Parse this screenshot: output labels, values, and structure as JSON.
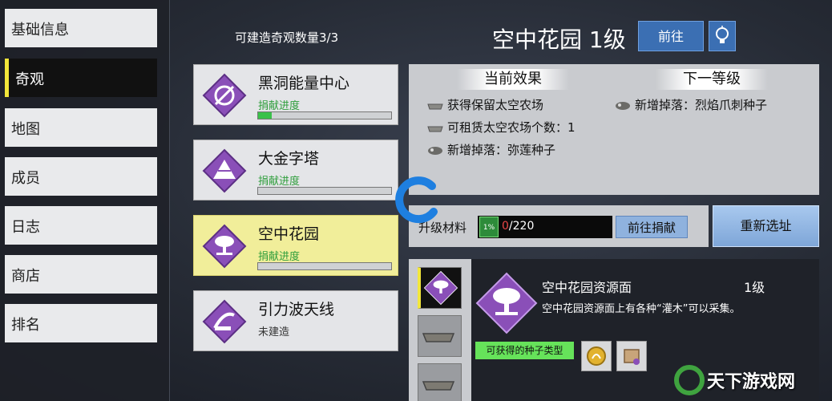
{
  "sidebar": {
    "items": [
      {
        "label": "基础信息",
        "active": false
      },
      {
        "label": "奇观",
        "active": true
      },
      {
        "label": "地图",
        "active": false
      },
      {
        "label": "成员",
        "active": false
      },
      {
        "label": "日志",
        "active": false
      },
      {
        "label": "商店",
        "active": false
      },
      {
        "label": "排名",
        "active": false
      }
    ]
  },
  "header": {
    "count_label": "可建造奇观数量3/3",
    "title": "空中花园 1级",
    "goto_label": "前往",
    "bulb_icon": "lightbulb-icon"
  },
  "wonders": [
    {
      "name": "黑洞能量中心",
      "status": "捐献进度",
      "progress": 0.1,
      "icon": "black-hole-icon"
    },
    {
      "name": "大金字塔",
      "status": "捐献进度",
      "progress": 0,
      "icon": "pyramid-icon"
    },
    {
      "name": "空中花园",
      "status": "捐献进度",
      "progress": 0,
      "icon": "tree-icon",
      "selected": true
    },
    {
      "name": "引力波天线",
      "status": "未建造",
      "icon": "antenna-icon"
    }
  ],
  "effects": {
    "current_title": "当前效果",
    "next_title": "下一等级",
    "current": [
      {
        "text": "获得保留太空农场",
        "icon": "farm-plate-icon"
      },
      {
        "text": "可租赁太空农场个数：1",
        "icon": "farm-plate-icon"
      },
      {
        "text": "新增掉落：弥莲种子",
        "icon": "seed-pod-icon"
      }
    ],
    "next": [
      {
        "text": "新增掉落：烈焰爪刺种子",
        "icon": "seed-pod-icon"
      }
    ]
  },
  "upgrade": {
    "label": "升级材料",
    "current": "0",
    "required": "/220",
    "material_icon": "material-token-icon",
    "donate_label": "前往捐献"
  },
  "reselect_label": "重新选址",
  "resource": {
    "name": "空中花园资源面",
    "level": "1级",
    "desc": "空中花园资源面上有各种“灌木”可以采集。",
    "seed_tag": "可获得的种子类型"
  },
  "watermark": "天下游戏网",
  "colors": {
    "accent_yellow": "#f2e63a",
    "button_blue": "#3b6fb3",
    "progress_green": "#3ac14a",
    "gem_purple": "#8a4fb8"
  }
}
